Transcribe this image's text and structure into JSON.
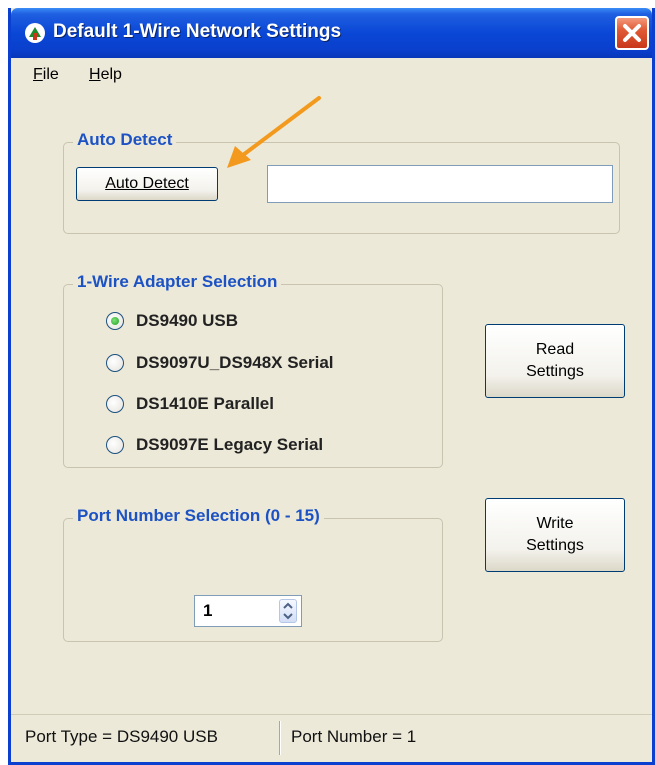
{
  "window": {
    "title": "Default 1-Wire Network Settings",
    "title_color": "#0a47d6",
    "close_color": "#c8371a"
  },
  "menu": {
    "file": {
      "accel": "F",
      "rest": "ile"
    },
    "help": {
      "accel": "H",
      "rest": "elp"
    }
  },
  "auto_detect": {
    "legend": "Auto Detect",
    "button_label": "Auto Detect",
    "result_value": ""
  },
  "adapter_selection": {
    "legend": "1-Wire Adapter Selection",
    "options": [
      {
        "label": "DS9490 USB",
        "selected": true
      },
      {
        "label": "DS9097U_DS948X Serial",
        "selected": false
      },
      {
        "label": "DS1410E Parallel",
        "selected": false
      },
      {
        "label": "DS9097E Legacy Serial",
        "selected": false
      }
    ]
  },
  "read_settings": {
    "line1": "Read",
    "line2": "Settings"
  },
  "port_selection": {
    "legend": "Port Number Selection (0 - 15)",
    "value": "1"
  },
  "write_settings": {
    "line1": "Write",
    "line2": "Settings"
  },
  "status": {
    "port_type": "Port Type = DS9490 USB",
    "port_number": "Port Number = 1"
  },
  "colors": {
    "legend_text": "#1c52c4",
    "annotation_arrow": "#f39a1e",
    "selected_radio": "#21a121"
  }
}
